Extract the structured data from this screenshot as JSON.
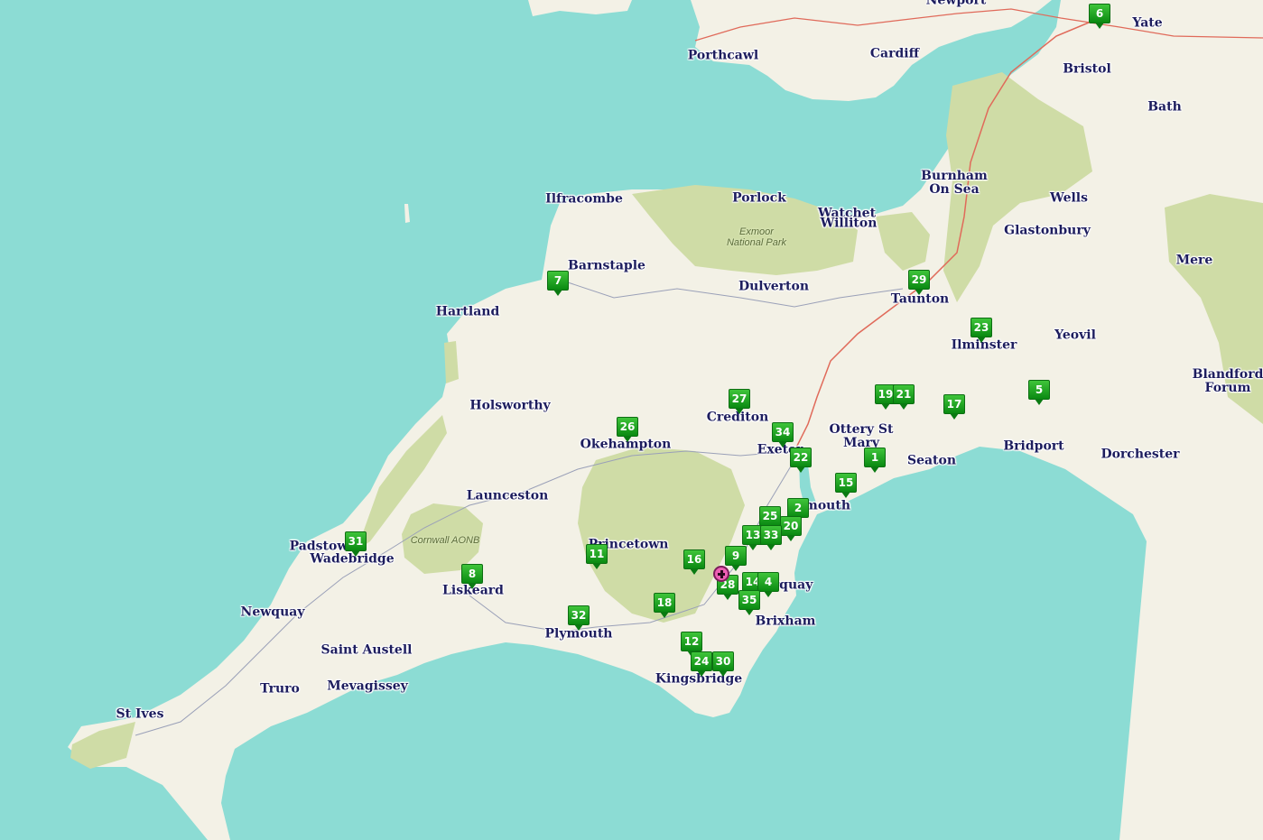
{
  "colors": {
    "sea": "#8cdcd4",
    "land": "#f3f1e6",
    "park": "#cfdca6",
    "road_major": "#e06a5a",
    "marker_green": "#1aa51f",
    "home_pink": "#ee5fb4",
    "label": "#1d1d5e"
  },
  "places": [
    {
      "key": "porthcawl",
      "label": "Porthcawl"
    },
    {
      "key": "cardiff",
      "label": "Cardiff"
    },
    {
      "key": "newport",
      "label": "Newport"
    },
    {
      "key": "yate",
      "label": "Yate"
    },
    {
      "key": "bristol",
      "label": "Bristol"
    },
    {
      "key": "bath",
      "label": "Bath"
    },
    {
      "key": "burnham",
      "label": "Burnham\nOn Sea"
    },
    {
      "key": "wells",
      "label": "Wells"
    },
    {
      "key": "glastonbury",
      "label": "Glastonbury"
    },
    {
      "key": "ilfracombe",
      "label": "Ilfracombe"
    },
    {
      "key": "porlock",
      "label": "Porlock"
    },
    {
      "key": "watchet",
      "label": "Watchet"
    },
    {
      "key": "williton",
      "label": "Williton"
    },
    {
      "key": "barnstaple",
      "label": "Barnstaple"
    },
    {
      "key": "dulverton",
      "label": "Dulverton"
    },
    {
      "key": "taunton",
      "label": "Taunton"
    },
    {
      "key": "mere",
      "label": "Mere"
    },
    {
      "key": "hartland",
      "label": "Hartland"
    },
    {
      "key": "ilminster",
      "label": "Ilminster"
    },
    {
      "key": "yeovil",
      "label": "Yeovil"
    },
    {
      "key": "blandford",
      "label": "Blandford\nForum"
    },
    {
      "key": "holsworthy",
      "label": "Holsworthy"
    },
    {
      "key": "crediton",
      "label": "Crediton"
    },
    {
      "key": "ottery",
      "label": "Ottery St\nMary"
    },
    {
      "key": "okehampton",
      "label": "Okehampton"
    },
    {
      "key": "exeter",
      "label": "Exeter"
    },
    {
      "key": "seaton",
      "label": "Seaton"
    },
    {
      "key": "bridport",
      "label": "Bridport"
    },
    {
      "key": "dorchester",
      "label": "Dorchester"
    },
    {
      "key": "launceston",
      "label": "Launceston"
    },
    {
      "key": "exmouth",
      "label": "Exmouth"
    },
    {
      "key": "padstow",
      "label": "Padstow"
    },
    {
      "key": "wadebridge",
      "label": "Wadebridge"
    },
    {
      "key": "princetown",
      "label": "Princetown"
    },
    {
      "key": "liskeard",
      "label": "Liskeard"
    },
    {
      "key": "torquay",
      "label": "Torquay"
    },
    {
      "key": "newquay",
      "label": "Newquay"
    },
    {
      "key": "brixham",
      "label": "Brixham"
    },
    {
      "key": "plymouth",
      "label": "Plymouth"
    },
    {
      "key": "saint_austell",
      "label": "Saint Austell"
    },
    {
      "key": "truro",
      "label": "Truro"
    },
    {
      "key": "mevagissey",
      "label": "Mevagissey"
    },
    {
      "key": "kingsbridge",
      "label": "Kingsbridge"
    },
    {
      "key": "st_ives",
      "label": "St Ives"
    }
  ],
  "parks": [
    {
      "key": "exmoor",
      "label": "Exmoor\nNational Park"
    },
    {
      "key": "cornwall_aonb",
      "label": "Cornwall AONB"
    }
  ],
  "markers": [
    {
      "key": "m6",
      "label": "6"
    },
    {
      "key": "m7",
      "label": "7"
    },
    {
      "key": "m29",
      "label": "29"
    },
    {
      "key": "m23",
      "label": "23"
    },
    {
      "key": "m19",
      "label": "19"
    },
    {
      "key": "m21",
      "label": "21"
    },
    {
      "key": "m17",
      "label": "17"
    },
    {
      "key": "m5",
      "label": "5"
    },
    {
      "key": "m27",
      "label": "27"
    },
    {
      "key": "m26",
      "label": "26"
    },
    {
      "key": "m34",
      "label": "34"
    },
    {
      "key": "m22",
      "label": "22"
    },
    {
      "key": "m1",
      "label": "1"
    },
    {
      "key": "m15",
      "label": "15"
    },
    {
      "key": "m2",
      "label": "2"
    },
    {
      "key": "m25",
      "label": "25"
    },
    {
      "key": "m20",
      "label": "20"
    },
    {
      "key": "m13",
      "label": "13"
    },
    {
      "key": "m33",
      "label": "33"
    },
    {
      "key": "m9",
      "label": "9"
    },
    {
      "key": "m16",
      "label": "16"
    },
    {
      "key": "m11",
      "label": "11"
    },
    {
      "key": "m31",
      "label": "31"
    },
    {
      "key": "m8",
      "label": "8"
    },
    {
      "key": "m14",
      "label": "14"
    },
    {
      "key": "m4",
      "label": "4"
    },
    {
      "key": "m28",
      "label": "28"
    },
    {
      "key": "m35",
      "label": "35"
    },
    {
      "key": "m18",
      "label": "18"
    },
    {
      "key": "m32",
      "label": "32"
    },
    {
      "key": "m12",
      "label": "12"
    },
    {
      "key": "m24",
      "label": "24"
    },
    {
      "key": "m30",
      "label": "30"
    }
  ],
  "home_marker": {
    "icon": "home-location-icon"
  }
}
